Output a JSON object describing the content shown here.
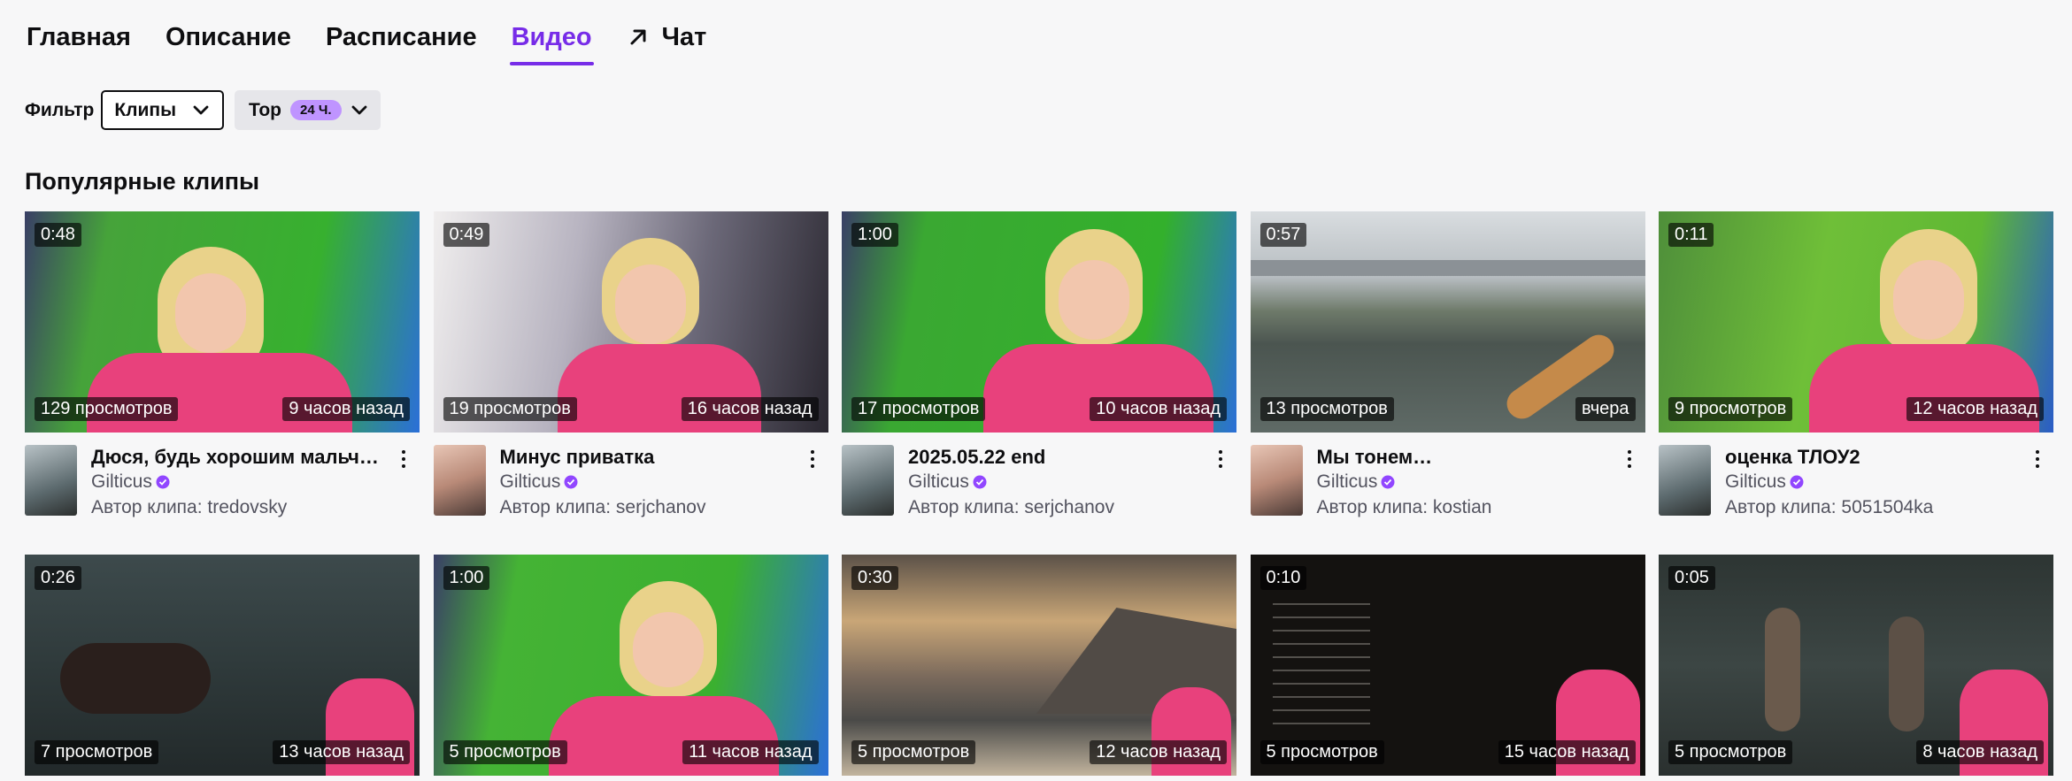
{
  "tabs": [
    {
      "label": "Главная"
    },
    {
      "label": "Описание"
    },
    {
      "label": "Расписание"
    },
    {
      "label": "Видео"
    },
    {
      "label": "Чат"
    }
  ],
  "filter": {
    "label": "Фильтр",
    "type_value": "Клипы",
    "sort_value": "Top",
    "sort_badge": "24 Ч."
  },
  "section_title": "Популярные клипы",
  "clips": [
    {
      "duration": "0:48",
      "views": "129 просмотров",
      "ago": "9 часов назад",
      "title": "Дюся, будь хорошим мальчиком...",
      "channel": "Gilticus",
      "author_prefix": "Автор клипа:",
      "author": "tredovsky"
    },
    {
      "duration": "0:49",
      "views": "19 просмотров",
      "ago": "16 часов назад",
      "title": "Минус приватка",
      "channel": "Gilticus",
      "author_prefix": "Автор клипа:",
      "author": "serjchanov"
    },
    {
      "duration": "1:00",
      "views": "17 просмотров",
      "ago": "10 часов назад",
      "title": "2025.05.22 end",
      "channel": "Gilticus",
      "author_prefix": "Автор клипа:",
      "author": "serjchanov"
    },
    {
      "duration": "0:57",
      "views": "13 просмотров",
      "ago": "вчера",
      "title": "Мы тонем…",
      "channel": "Gilticus",
      "author_prefix": "Автор клипа:",
      "author": "kostian"
    },
    {
      "duration": "0:11",
      "views": "9 просмотров",
      "ago": "12 часов назад",
      "title": "оценка ТЛОУ2",
      "channel": "Gilticus",
      "author_prefix": "Автор клипа:",
      "author": "5051504ka"
    },
    {
      "duration": "0:26",
      "views": "7 просмотров",
      "ago": "13 часов назад"
    },
    {
      "duration": "1:00",
      "views": "5 просмотров",
      "ago": "11 часов назад"
    },
    {
      "duration": "0:30",
      "views": "5 просмотров",
      "ago": "12 часов назад"
    },
    {
      "duration": "0:10",
      "views": "5 просмотров",
      "ago": "15 часов назад"
    },
    {
      "duration": "0:05",
      "views": "5 просмотров",
      "ago": "8 часов назад"
    }
  ],
  "colors": {
    "accent": "#772ce8",
    "badge": "#bf94ff"
  }
}
